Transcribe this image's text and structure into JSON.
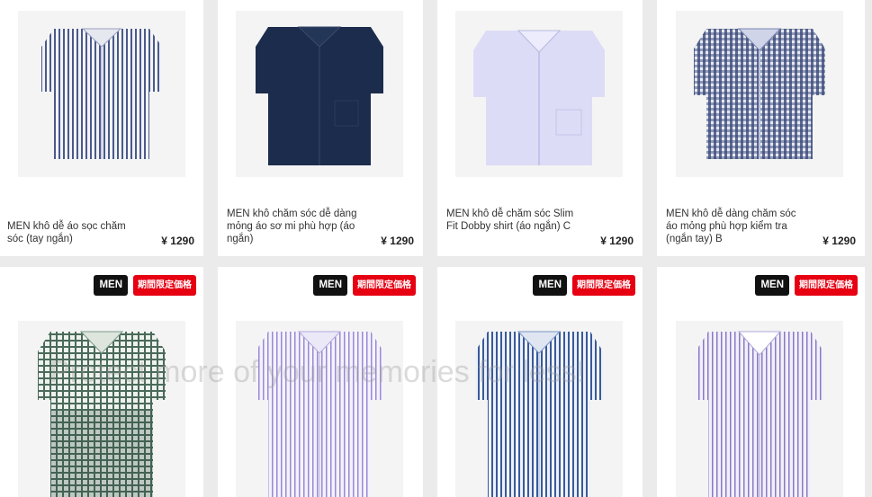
{
  "products_row1": [
    {
      "name": "MEN khô dễ áo sọc chăm sóc (tay ngắn)",
      "price": "¥ 1290",
      "image": "striped-shirt-image",
      "color": "#4a5a8a"
    },
    {
      "name": "MEN khô chăm sóc dễ dàng mỏng áo sơ mi phù hợp (áo ngắn)",
      "price": "¥ 1290",
      "image": "navy-shirt-image",
      "color": "#1a2a4a"
    },
    {
      "name": "MEN khô dễ chăm sóc Slim Fit Dobby shirt (áo ngắn) C",
      "price": "¥ 1290",
      "image": "lavender-shirt-image",
      "color": "#d4d4f2"
    },
    {
      "name": "MEN khô dễ dàng chăm sóc áo mỏng phù hợp kiểm tra (ngắn tay) B",
      "price": "¥ 1290",
      "image": "gingham-shirt-image",
      "color": "#3a4a7a"
    }
  ],
  "products_row2": [
    {
      "badge_men": "MEN",
      "badge_sale": "期間限定価格",
      "image": "green-check-shirt-image",
      "color": "#4a6a5a"
    },
    {
      "badge_men": "MEN",
      "badge_sale": "期間限定価格",
      "image": "purple-stripe-shirt-image",
      "color": "#9a8ad2"
    },
    {
      "badge_men": "MEN",
      "badge_sale": "期間限定価格",
      "image": "blue-stripe-shirt-image",
      "color": "#3a5a9a"
    },
    {
      "badge_men": "MEN",
      "badge_sale": "期間限定価格",
      "image": "violet-stripe-shirt-image",
      "color": "#8a7ac2"
    }
  ],
  "watermark": "Protect more of your memories for less!"
}
